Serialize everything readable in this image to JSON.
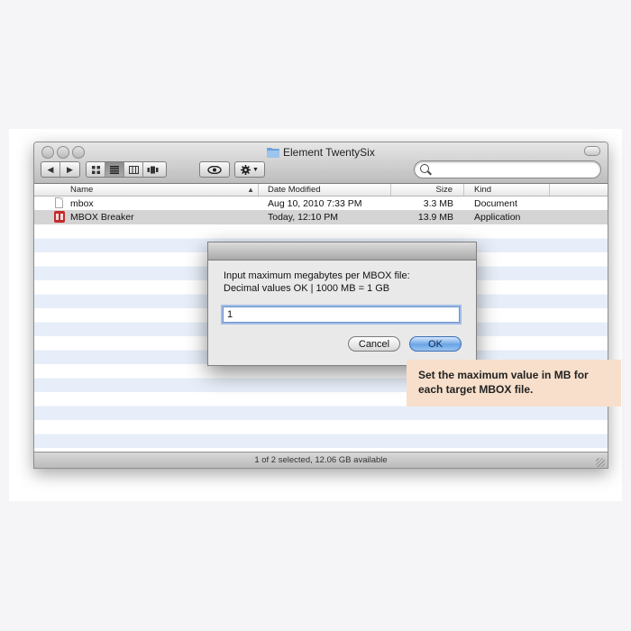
{
  "window": {
    "title": "Element TwentySix",
    "status": "1 of 2 selected, 12.06 GB available"
  },
  "toolbar": {
    "view_icons": [
      "icon-view-icon",
      "list-view-icon",
      "column-view-icon",
      "cover-flow-icon"
    ],
    "active_view": "list",
    "quicklook_icon": "eye-icon",
    "action_icon": "gear-icon"
  },
  "columns": [
    {
      "key": "name",
      "label": "Name"
    },
    {
      "key": "date",
      "label": "Date Modified"
    },
    {
      "key": "size",
      "label": "Size"
    },
    {
      "key": "kind",
      "label": "Kind"
    }
  ],
  "files": [
    {
      "name": "mbox",
      "date": "Aug 10, 2010 7:33 PM",
      "size": "3.3 MB",
      "kind": "Document",
      "icon": "document-icon",
      "selected": false
    },
    {
      "name": "MBOX Breaker",
      "date": "Today, 12:10 PM",
      "size": "13.9 MB",
      "kind": "Application",
      "icon": "application-icon",
      "selected": true
    }
  ],
  "dialog": {
    "prompt_line1": "Input maximum megabytes per MBOX file:",
    "prompt_line2": "Decimal values OK | 1000 MB = 1 GB",
    "input_value": "1",
    "cancel_label": "Cancel",
    "ok_label": "OK"
  },
  "callout": {
    "line1": "Set the maximum value in MB for",
    "line2": "each target MBOX file."
  },
  "colors": {
    "selection_row": "#d4d4d4",
    "alt_row": "#e7eef9",
    "callout_bg": "#f7dfcb",
    "ok_button": "#6aa5e6"
  }
}
